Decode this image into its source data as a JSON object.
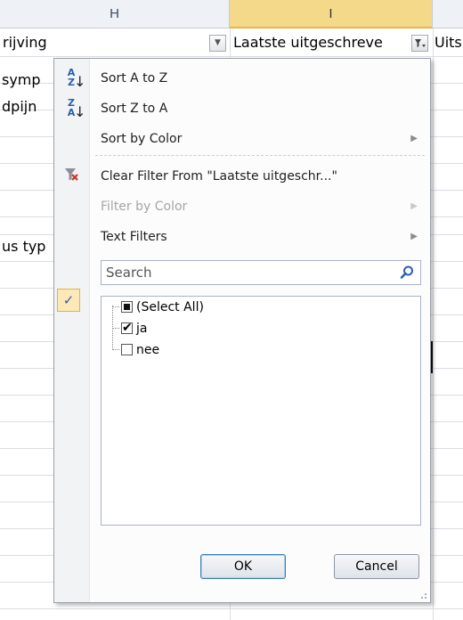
{
  "columns": {
    "h": "H",
    "i": "I"
  },
  "header_row": {
    "col_h_text": "rijving",
    "col_i_text": "Laatste uitgeschreve",
    "col_j_text": "Uits"
  },
  "cells": [
    {
      "text": "symp"
    },
    {
      "text": "dpijn"
    },
    {
      "text": "us typ"
    }
  ],
  "menu": {
    "sort_az": "Sort A to Z",
    "sort_za": "Sort Z to A",
    "sort_by_color": "Sort by Color",
    "clear_filter": "Clear Filter From \"Laatste uitgeschr...\"",
    "filter_by_color": "Filter by Color",
    "text_filters": "Text Filters",
    "search_placeholder": "Search",
    "list_items": [
      {
        "label": "(Select All)",
        "state": "indeterminate"
      },
      {
        "label": "ja",
        "state": "checked"
      },
      {
        "label": "nee",
        "state": "unchecked"
      }
    ],
    "ok_label": "OK",
    "cancel_label": "Cancel"
  },
  "icons": {
    "sort_az": "sort-ascending-icon",
    "sort_za": "sort-descending-icon",
    "clear_filter": "clear-filter-icon",
    "search": "search-icon",
    "filter_active": "filter-funnel-icon",
    "dropdown": "dropdown-arrow-icon"
  },
  "colors": {
    "selected_column": "#f5d98a",
    "accent": "#2a5fb0",
    "clear_filter_red": "#d0302a"
  }
}
